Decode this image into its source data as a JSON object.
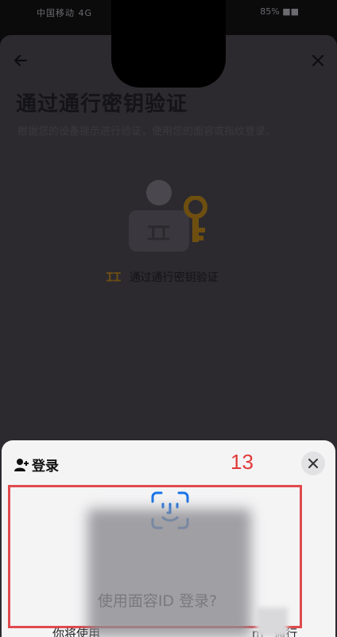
{
  "status_bar": {
    "left": "中国移动 4G",
    "right": "85% ■■"
  },
  "header": {
    "title": "通过通行密钥验证",
    "subtitle": "根据您的设备提示进行验证，使用您的面容或指纹登录。"
  },
  "illustration": {
    "face_glyph": "ꞮꞮ",
    "verify_glyph": "ꞮꞮ",
    "verify_text": "通过通行密钥验证"
  },
  "login_sheet": {
    "title": "登录",
    "annotation": "13",
    "prompt": "使用面容ID 登录?",
    "desc_left": "你将使用",
    "desc_right": "m” 通行"
  },
  "colors": {
    "accent_blue": "#1a73e8",
    "annotation_red": "#e23a3a",
    "key_gold": "#7a5a12"
  }
}
